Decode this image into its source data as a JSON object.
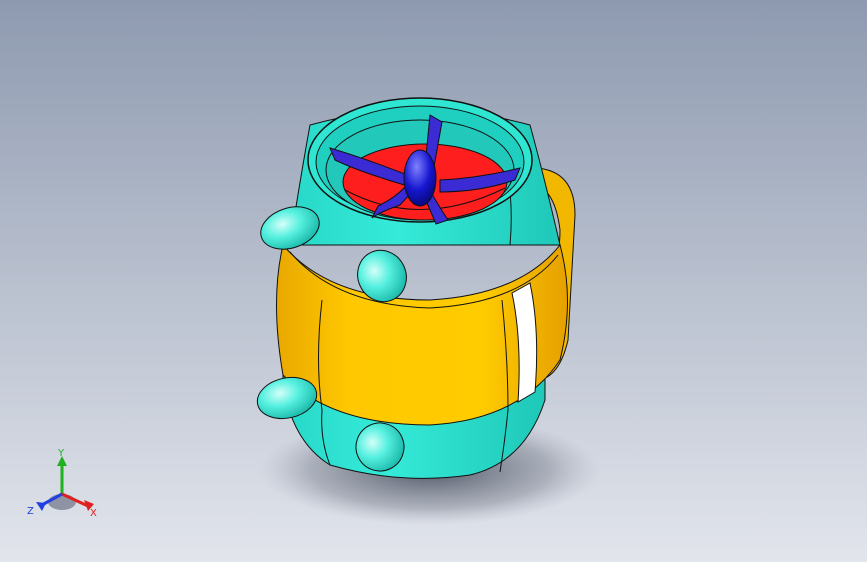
{
  "viewport": {
    "background_top": "#8e9ab0",
    "background_bottom": "#e2e5ec"
  },
  "model": {
    "colors": {
      "shell": "#2fe6d3",
      "band": "#f8c200",
      "fan_hub": "#ff1e1e",
      "blades": "#3b2bd4",
      "stripe": "#ffffff",
      "edge": "#111111"
    },
    "parts": [
      "housing-shell",
      "center-band",
      "fan-assembly",
      "spinner-cone",
      "bolt-bosses",
      "side-handle"
    ]
  },
  "triad": {
    "x_label": "X",
    "y_label": "Y",
    "z_label": "Z",
    "x_color": "#e02020",
    "y_color": "#20b020",
    "z_color": "#2040e0"
  }
}
